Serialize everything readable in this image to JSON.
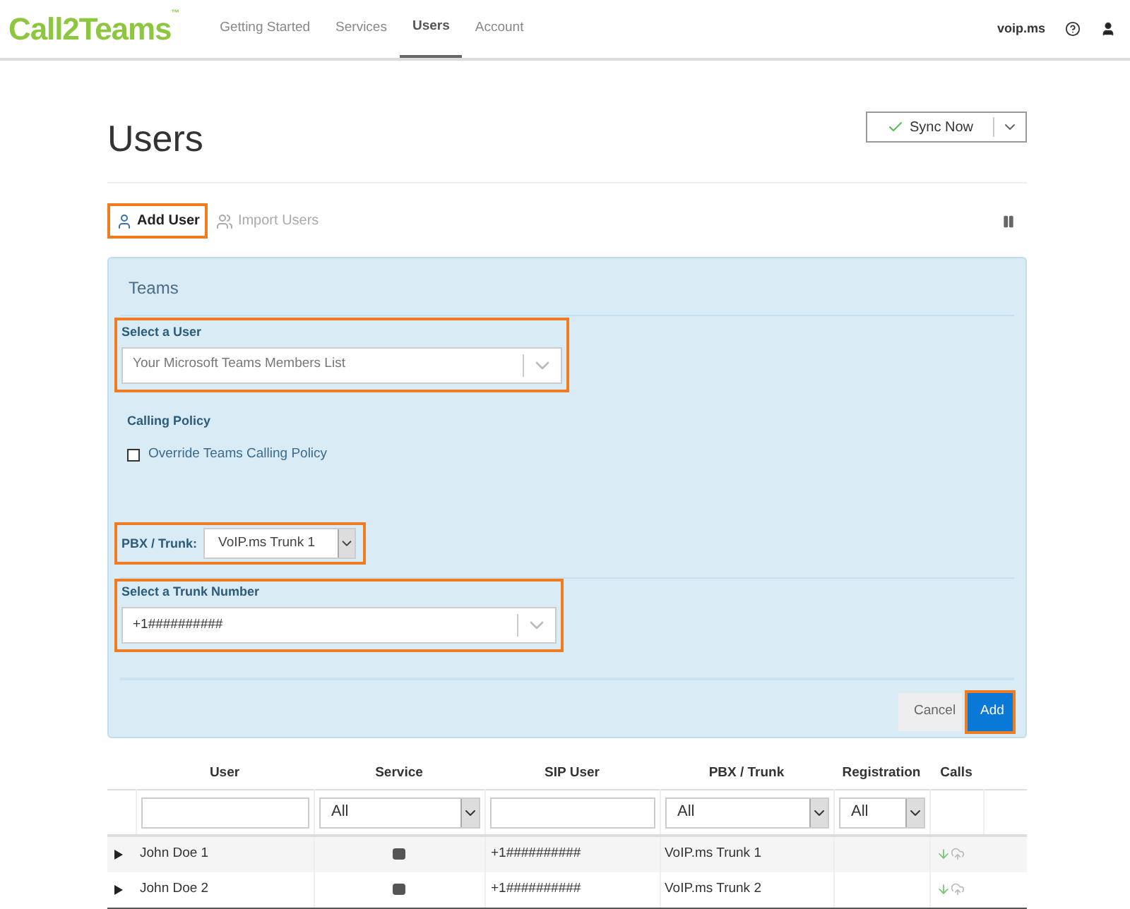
{
  "header": {
    "logo": "Call2Teams",
    "logo_mark": "™",
    "nav": [
      {
        "label": "Getting Started",
        "selected": false
      },
      {
        "label": "Services",
        "selected": false
      },
      {
        "label": "Users",
        "selected": true
      },
      {
        "label": "Account",
        "selected": false
      }
    ],
    "account": "voip.ms"
  },
  "page": {
    "title": "Users",
    "sync_button": "Sync Now"
  },
  "toolbar": [
    {
      "label": "Add User",
      "selected": true,
      "highlighted": true
    },
    {
      "label": "Import Users",
      "selected": false,
      "highlighted": false
    }
  ],
  "panel": {
    "title": "Teams",
    "select_user": {
      "label": "Select a User",
      "placeholder": "Your Microsoft Teams Members List",
      "highlighted": true
    },
    "calling_policy": {
      "heading": "Calling Policy",
      "checkbox_label": "Override Teams Calling Policy",
      "checked": false
    },
    "pbx": {
      "label": "PBX / Trunk:",
      "value": "VoIP.ms Trunk 1",
      "highlighted": true
    },
    "trunk_number": {
      "label": "Select a Trunk Number",
      "value": "+1##########",
      "highlighted": true
    },
    "buttons": [
      {
        "label": "Cancel",
        "kind": "secondary",
        "highlighted": false
      },
      {
        "label": "Add",
        "kind": "primary",
        "highlighted": true
      }
    ]
  },
  "table": {
    "columns": [
      "User",
      "Service",
      "SIP User",
      "PBX / Trunk",
      "Registration",
      "Calls"
    ],
    "filters": [
      {
        "kind": "text"
      },
      {
        "kind": "select",
        "value": "All"
      },
      {
        "kind": "text"
      },
      {
        "kind": "select",
        "value": "All"
      },
      {
        "kind": "select",
        "value": "All"
      },
      {
        "kind": "none"
      }
    ],
    "rows": [
      {
        "user": "John Doe 1",
        "sip_user": "+1##########",
        "pbx": "VoIP.ms Trunk 1"
      },
      {
        "user": "John Doe 2",
        "sip_user": "+1##########",
        "pbx": "VoIP.ms Trunk 2"
      }
    ]
  }
}
